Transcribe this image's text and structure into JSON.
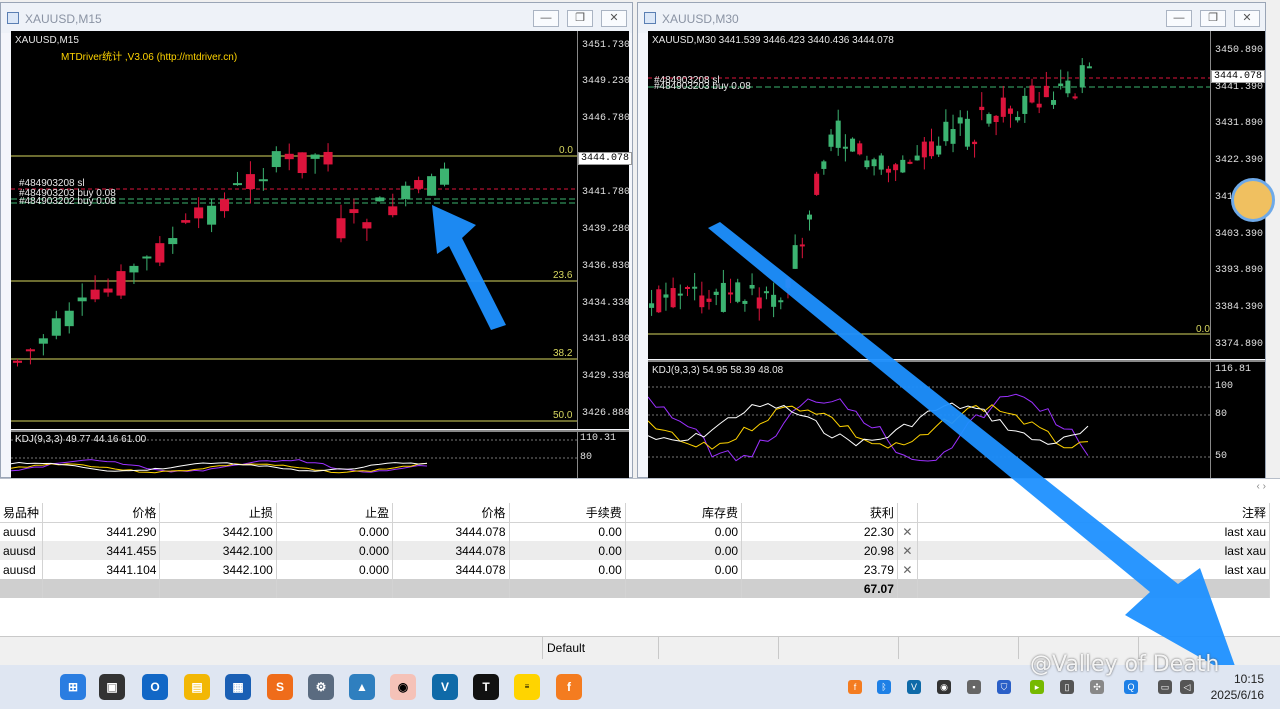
{
  "window_left": {
    "title": "XAUUSD,M15",
    "chart_header": "XAUUSD,M15",
    "indicator_label": "MTDriver统计 ,V3.06 (http://mtdriver.cn)",
    "price_labels": [
      "3451.730",
      "3449.230",
      "3446.780",
      "3444.078",
      "3441.780",
      "3439.280",
      "3436.830",
      "3434.330",
      "3431.830",
      "3429.330",
      "3426.880"
    ],
    "current_price": "3444.078",
    "fib_levels": [
      "0.0",
      "23.6",
      "38.2",
      "50.0"
    ],
    "order_text_1": "#484903208 sl",
    "order_text_2": "#484903203 buy 0.08",
    "order_text_3": "#484903202 buy 0.08",
    "kdj_label": "KDJ(9,3,3) 49.77 44.16 61.00",
    "kdj_axis": [
      "110.31",
      "80"
    ]
  },
  "window_right": {
    "title": "XAUUSD,M30",
    "chart_header": "XAUUSD,M30  3441.539 3446.423 3440.436 3444.078",
    "price_labels": [
      "3450.890",
      "3441.390",
      "3431.890",
      "3422.390",
      "3412.890",
      "3403.390",
      "3393.890",
      "3384.390",
      "3374.890"
    ],
    "current_price": "3444.078",
    "fib_level": "0.0",
    "order_text": "#484903208 sl",
    "order_text_2": "#484903203 buy 0.08",
    "kdj_label": "KDJ(9,3,3) 54.95 58.39 48.08",
    "kdj_axis": [
      "116.81",
      "100",
      "80",
      "50"
    ]
  },
  "terminal": {
    "headers": [
      "易品种",
      "价格",
      "止损",
      "止盈",
      "价格",
      "手续费",
      "库存费",
      "获利",
      "",
      "注释"
    ],
    "rows": [
      [
        "auusd",
        "3441.290",
        "3442.100",
        "0.000",
        "3444.078",
        "0.00",
        "0.00",
        "22.30",
        "✕",
        "last xau"
      ],
      [
        "auusd",
        "3441.455",
        "3442.100",
        "0.000",
        "3444.078",
        "0.00",
        "0.00",
        "20.98",
        "✕",
        "last xau"
      ],
      [
        "auusd",
        "3441.104",
        "3442.100",
        "0.000",
        "3444.078",
        "0.00",
        "0.00",
        "23.79",
        "✕",
        "last xau"
      ]
    ],
    "total": "67.07"
  },
  "statusbar": {
    "profile": "Default"
  },
  "taskbar": {
    "time": "10:15",
    "date": "2025/6/16",
    "watermark": "@Valley of Death"
  },
  "colors": {
    "bull": "#3cb371",
    "bear": "#dc143c",
    "fib": "#d8d860",
    "arrow": "#1e90ff"
  }
}
